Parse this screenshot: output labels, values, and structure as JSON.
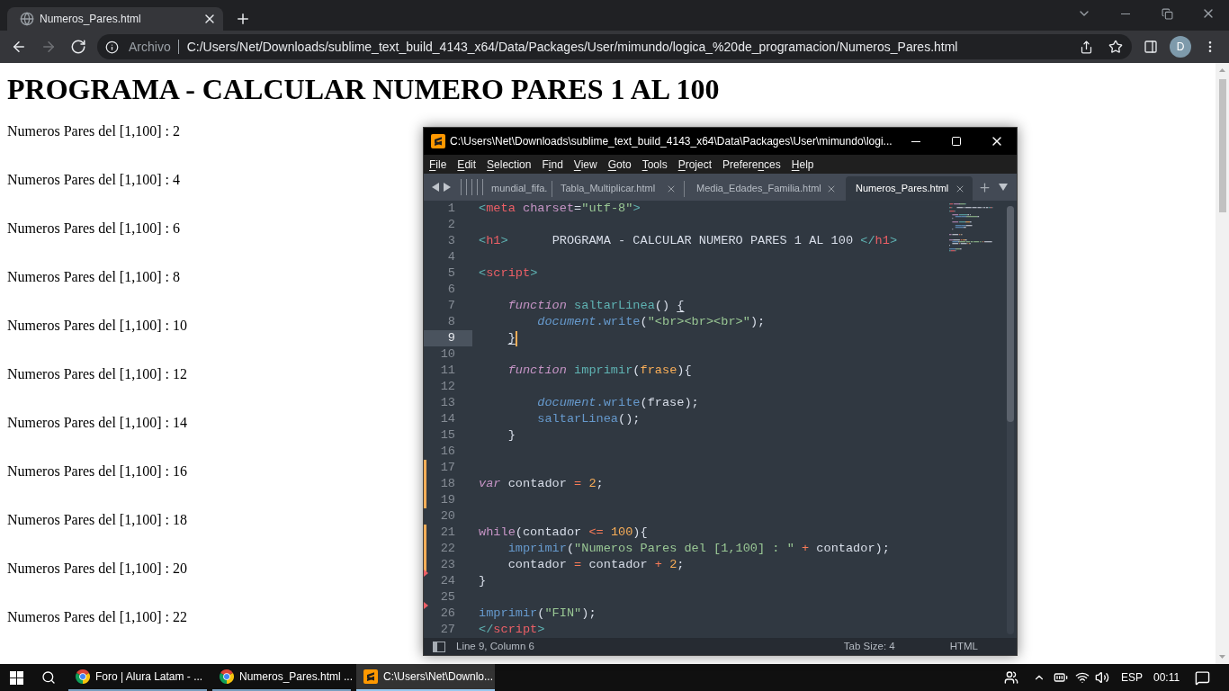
{
  "browser": {
    "tabs": [
      {
        "title": "Numeros_Pares.html",
        "selected": true
      }
    ],
    "nav_buttons": [
      {
        "kind": "back",
        "disabled": false
      },
      {
        "kind": "forward",
        "disabled": true
      },
      {
        "kind": "reload",
        "disabled": false
      }
    ],
    "address_bar": {
      "security_label": "Archivo",
      "url": "C:/Users/Net/Downloads/sublime_text_build_4143_x64/Data/Packages/User/mimundo/logica_%20de_programacion/Numeros_Pares.html"
    },
    "profile": {
      "initial": "D"
    }
  },
  "page": {
    "heading": "PROGRAMA - CALCULAR NUMERO PARES 1 AL 100",
    "lines": [
      "Numeros Pares del [1,100] : 2",
      "Numeros Pares del [1,100] : 4",
      "Numeros Pares del [1,100] : 6",
      "Numeros Pares del [1,100] : 8",
      "Numeros Pares del [1,100] : 10",
      "Numeros Pares del [1,100] : 12",
      "Numeros Pares del [1,100] : 14",
      "Numeros Pares del [1,100] : 16",
      "Numeros Pares del [1,100] : 18",
      "Numeros Pares del [1,100] : 20",
      "Numeros Pares del [1,100] : 22"
    ]
  },
  "editor_window": {
    "title": "C:\\Users\\Net\\Downloads\\sublime_text_build_4143_x64\\Data\\Packages\\User\\mimundo\\logi...",
    "menu": [
      {
        "key": "F",
        "rest": "ile"
      },
      {
        "key": "E",
        "rest": "dit"
      },
      {
        "key": "S",
        "rest": "election"
      },
      {
        "lead": "F",
        "key": "i",
        "rest": "nd"
      },
      {
        "key": "V",
        "rest": "iew"
      },
      {
        "key": "G",
        "rest": "oto"
      },
      {
        "key": "T",
        "rest": "ools"
      },
      {
        "key": "P",
        "rest": "roject"
      },
      {
        "lead": "Prefere",
        "key": "n",
        "rest": "ces"
      },
      {
        "key": "H",
        "rest": "elp"
      }
    ],
    "tabs": [
      {
        "label": "mundial_fifa.",
        "selected": false,
        "close_button": false
      },
      {
        "label": "Tabla_Multiplicar.html",
        "selected": false,
        "close_button": true
      },
      {
        "label": "Media_Edades_Familia.html",
        "selected": false,
        "close_button": true
      },
      {
        "label": "Numeros_Pares.html",
        "selected": true,
        "close_button": true
      }
    ],
    "lines": [
      {
        "number": "1",
        "current": false,
        "modified": false,
        "deleted_below": false,
        "tokens": [
          {
            "kind": "tag",
            "text": "<"
          },
          {
            "kind": "tagname",
            "text": "meta"
          },
          {
            "kind": "attr",
            "text": " charset"
          },
          {
            "kind": "plain",
            "text": "="
          },
          {
            "kind": "string",
            "text": "\"utf-8\""
          },
          {
            "kind": "tag",
            "text": ">"
          }
        ]
      },
      {
        "number": "2",
        "current": false,
        "modified": false,
        "deleted_below": false
      },
      {
        "number": "3",
        "current": false,
        "modified": false,
        "deleted_below": false,
        "tokens": [
          {
            "kind": "tag",
            "text": "<"
          },
          {
            "kind": "tagname",
            "text": "h1"
          },
          {
            "kind": "tag",
            "text": ">"
          },
          {
            "kind": "plain",
            "text": "      PROGRAMA - CALCULAR NUMERO PARES 1 AL 100 "
          },
          {
            "kind": "tag",
            "text": "</"
          },
          {
            "kind": "tagname",
            "text": "h1"
          },
          {
            "kind": "tag",
            "text": ">"
          }
        ]
      },
      {
        "number": "4",
        "current": false,
        "modified": false,
        "deleted_below": false
      },
      {
        "number": "5",
        "current": false,
        "modified": false,
        "deleted_below": false,
        "tokens": [
          {
            "kind": "tag",
            "text": "<"
          },
          {
            "kind": "tagname",
            "text": "script"
          },
          {
            "kind": "tag",
            "text": ">"
          }
        ]
      },
      {
        "number": "6",
        "current": false,
        "modified": false,
        "deleted_below": false
      },
      {
        "number": "7",
        "current": false,
        "modified": false,
        "deleted_below": false,
        "tokens": [
          {
            "kind": "keyword",
            "text": "    function"
          },
          {
            "kind": "func",
            "text": " saltarLinea"
          },
          {
            "kind": "plain",
            "text": "() "
          },
          {
            "kind": "match",
            "text": "{"
          }
        ]
      },
      {
        "number": "8",
        "current": false,
        "modified": false,
        "deleted_below": false,
        "tokens": [
          {
            "kind": "object",
            "text": "        document"
          },
          {
            "kind": "call",
            "text": ".write"
          },
          {
            "kind": "plain",
            "text": "("
          },
          {
            "kind": "string",
            "text": "\"<br><br><br>\""
          },
          {
            "kind": "plain",
            "text": ");"
          }
        ]
      },
      {
        "number": "9",
        "current": true,
        "modified": false,
        "deleted_below": false,
        "tokens": [
          {
            "kind": "match",
            "text": "    }"
          }
        ]
      },
      {
        "number": "10",
        "current": false,
        "modified": false,
        "deleted_below": false
      },
      {
        "number": "11",
        "current": false,
        "modified": false,
        "deleted_below": false,
        "tokens": [
          {
            "kind": "keyword",
            "text": "    function"
          },
          {
            "kind": "func",
            "text": " imprimir"
          },
          {
            "kind": "plain",
            "text": "("
          },
          {
            "kind": "param",
            "text": "frase"
          },
          {
            "kind": "plain",
            "text": "){"
          }
        ]
      },
      {
        "number": "12",
        "current": false,
        "modified": false,
        "deleted_below": false
      },
      {
        "number": "13",
        "current": false,
        "modified": false,
        "deleted_below": false,
        "tokens": [
          {
            "kind": "object",
            "text": "        document"
          },
          {
            "kind": "call",
            "text": ".write"
          },
          {
            "kind": "plain",
            "text": "(frase);"
          }
        ]
      },
      {
        "number": "14",
        "current": false,
        "modified": false,
        "deleted_below": false,
        "tokens": [
          {
            "kind": "call",
            "text": "        saltarLinea"
          },
          {
            "kind": "plain",
            "text": "();"
          }
        ]
      },
      {
        "number": "15",
        "current": false,
        "modified": false,
        "deleted_below": false,
        "tokens": [
          {
            "kind": "plain",
            "text": "    }"
          }
        ]
      },
      {
        "number": "16",
        "current": false,
        "modified": false,
        "deleted_below": false
      },
      {
        "number": "17",
        "current": false,
        "modified": true,
        "deleted_below": false
      },
      {
        "number": "18",
        "current": false,
        "modified": true,
        "deleted_below": false,
        "tokens": [
          {
            "kind": "keyword",
            "text": "var"
          },
          {
            "kind": "plain",
            "text": " contador "
          },
          {
            "kind": "op",
            "text": "="
          },
          {
            "kind": "number",
            "text": " 2"
          },
          {
            "kind": "plain",
            "text": ";"
          }
        ]
      },
      {
        "number": "19",
        "current": false,
        "modified": true,
        "deleted_below": false
      },
      {
        "number": "20",
        "current": false,
        "modified": false,
        "deleted_below": false
      },
      {
        "number": "21",
        "current": false,
        "modified": true,
        "deleted_below": false,
        "tokens": [
          {
            "kind": "control",
            "text": "while"
          },
          {
            "kind": "plain",
            "text": "(contador "
          },
          {
            "kind": "op",
            "text": "<="
          },
          {
            "kind": "number",
            "text": " 100"
          },
          {
            "kind": "plain",
            "text": "){"
          }
        ]
      },
      {
        "number": "22",
        "current": false,
        "modified": true,
        "deleted_below": false,
        "tokens": [
          {
            "kind": "call",
            "text": "    imprimir"
          },
          {
            "kind": "plain",
            "text": "("
          },
          {
            "kind": "string",
            "text": "\"Numeros Pares del [1,100] : \""
          },
          {
            "kind": "op",
            "text": " +"
          },
          {
            "kind": "plain",
            "text": " contador);"
          }
        ]
      },
      {
        "number": "23",
        "current": false,
        "modified": true,
        "deleted_below": true,
        "tokens": [
          {
            "kind": "plain",
            "text": "    contador "
          },
          {
            "kind": "op",
            "text": "="
          },
          {
            "kind": "plain",
            "text": " contador "
          },
          {
            "kind": "op",
            "text": "+"
          },
          {
            "kind": "number",
            "text": " 2"
          },
          {
            "kind": "plain",
            "text": ";"
          }
        ]
      },
      {
        "number": "24",
        "current": false,
        "modified": false,
        "deleted_below": false,
        "tokens": [
          {
            "kind": "plain",
            "text": "}"
          }
        ]
      },
      {
        "number": "25",
        "current": false,
        "modified": false,
        "deleted_below": true
      },
      {
        "number": "26",
        "current": false,
        "modified": false,
        "deleted_below": false,
        "tokens": [
          {
            "kind": "call",
            "text": "imprimir"
          },
          {
            "kind": "plain",
            "text": "("
          },
          {
            "kind": "string",
            "text": "\"FIN\""
          },
          {
            "kind": "plain",
            "text": ");"
          }
        ]
      },
      {
        "number": "27",
        "current": false,
        "modified": false,
        "deleted_below": false,
        "tokens": [
          {
            "kind": "tag",
            "text": "</"
          },
          {
            "kind": "tagname",
            "text": "script"
          },
          {
            "kind": "tag",
            "text": ">"
          }
        ]
      }
    ],
    "status_bar": {
      "position": "Line 9, Column 6",
      "tab_size": "Tab Size: 4",
      "syntax": "HTML"
    }
  },
  "taskbar": {
    "items": [
      {
        "kind": "browser",
        "label": "Foro | Alura Latam - ...",
        "selected": false
      },
      {
        "kind": "browser",
        "label": "Numeros_Pares.html ...",
        "selected": false
      },
      {
        "kind": "editor",
        "label": "C:\\Users\\Net\\Downlo...",
        "selected": true
      }
    ],
    "language": "ESP",
    "time": "00:11"
  }
}
